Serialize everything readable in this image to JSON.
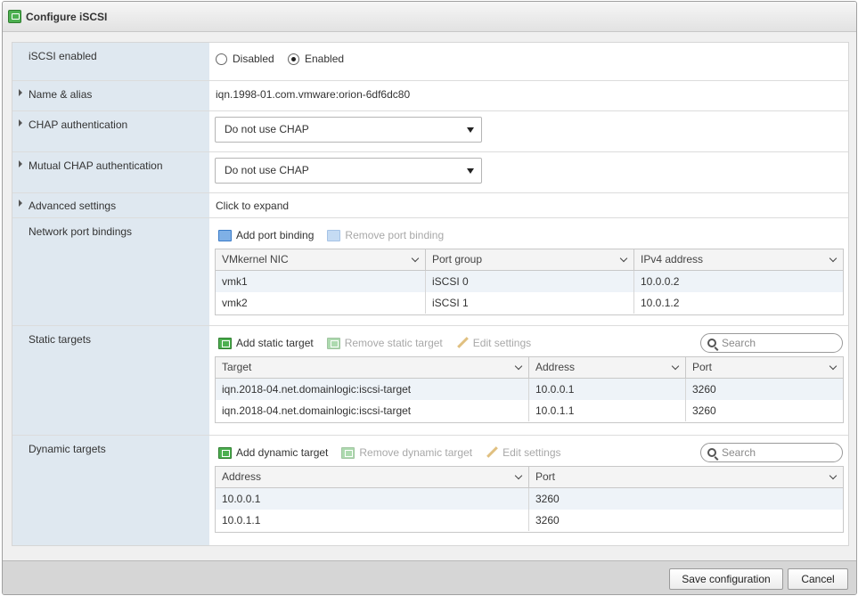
{
  "dialog": {
    "title": "Configure iSCSI"
  },
  "iscsi_enabled": {
    "label": "iSCSI enabled",
    "disabled_label": "Disabled",
    "enabled_label": "Enabled",
    "selected": "Enabled"
  },
  "name_alias": {
    "label": "Name & alias",
    "value": "iqn.1998-01.com.vmware:orion-6df6dc80"
  },
  "chap": {
    "label": "CHAP authentication",
    "value": "Do not use CHAP"
  },
  "mutual_chap": {
    "label": "Mutual CHAP authentication",
    "value": "Do not use CHAP"
  },
  "advanced": {
    "label": "Advanced settings",
    "value": "Click to expand"
  },
  "port_bindings": {
    "label": "Network port bindings",
    "add_label": "Add port binding",
    "remove_label": "Remove port binding",
    "columns": [
      "VMkernel NIC",
      "Port group",
      "IPv4 address"
    ],
    "rows": [
      [
        "vmk1",
        "iSCSI 0",
        "10.0.0.2"
      ],
      [
        "vmk2",
        "iSCSI 1",
        "10.0.1.2"
      ]
    ]
  },
  "static_targets": {
    "label": "Static targets",
    "add_label": "Add static target",
    "remove_label": "Remove static target",
    "edit_label": "Edit settings",
    "search_placeholder": "Search",
    "columns": [
      "Target",
      "Address",
      "Port"
    ],
    "rows": [
      [
        "iqn.2018-04.net.domainlogic:iscsi-target",
        "10.0.0.1",
        "3260"
      ],
      [
        "iqn.2018-04.net.domainlogic:iscsi-target",
        "10.0.1.1",
        "3260"
      ]
    ]
  },
  "dynamic_targets": {
    "label": "Dynamic targets",
    "add_label": "Add dynamic target",
    "remove_label": "Remove dynamic target",
    "edit_label": "Edit settings",
    "search_placeholder": "Search",
    "columns": [
      "Address",
      "Port"
    ],
    "rows": [
      [
        "10.0.0.1",
        "3260"
      ],
      [
        "10.0.1.1",
        "3260"
      ]
    ]
  },
  "footer": {
    "save_label": "Save configuration",
    "cancel_label": "Cancel"
  }
}
